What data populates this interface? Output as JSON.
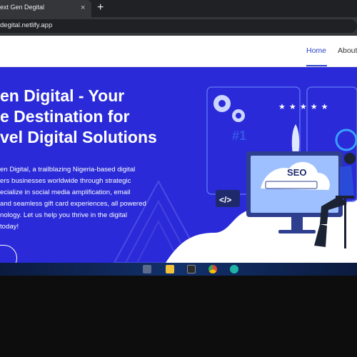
{
  "browser": {
    "tab_title": "ext Gen Degital",
    "tab_close": "×",
    "new_tab": "+",
    "url": "degital.netlify.app"
  },
  "nav": {
    "items": [
      {
        "label": "Home"
      },
      {
        "label": "About"
      }
    ]
  },
  "hero": {
    "title_lines": [
      "en Digital - Your",
      "e Destination for",
      "vel Digital Solutions"
    ],
    "description_lines": [
      "en Digital, a trailblazing Nigeria-based digital",
      "ers businesses worldwide through strategic",
      "ecialize in social media amplification, email",
      "and seamless gift card experiences, all powered",
      "nology. Let us help you thrive in the digital",
      "today!"
    ],
    "illustration": {
      "seo_text": "SEO",
      "rank_text": "#1",
      "code_text": "</>",
      "stars": "★ ★ ★ ★ ★"
    }
  },
  "colors": {
    "hero_bg": "#2a2ad8",
    "accent": "#2b46c9"
  },
  "taskbar": {
    "icons": [
      "task-view-icon",
      "file-explorer-icon",
      "terminal-icon",
      "chrome-icon",
      "edge-icon"
    ]
  }
}
